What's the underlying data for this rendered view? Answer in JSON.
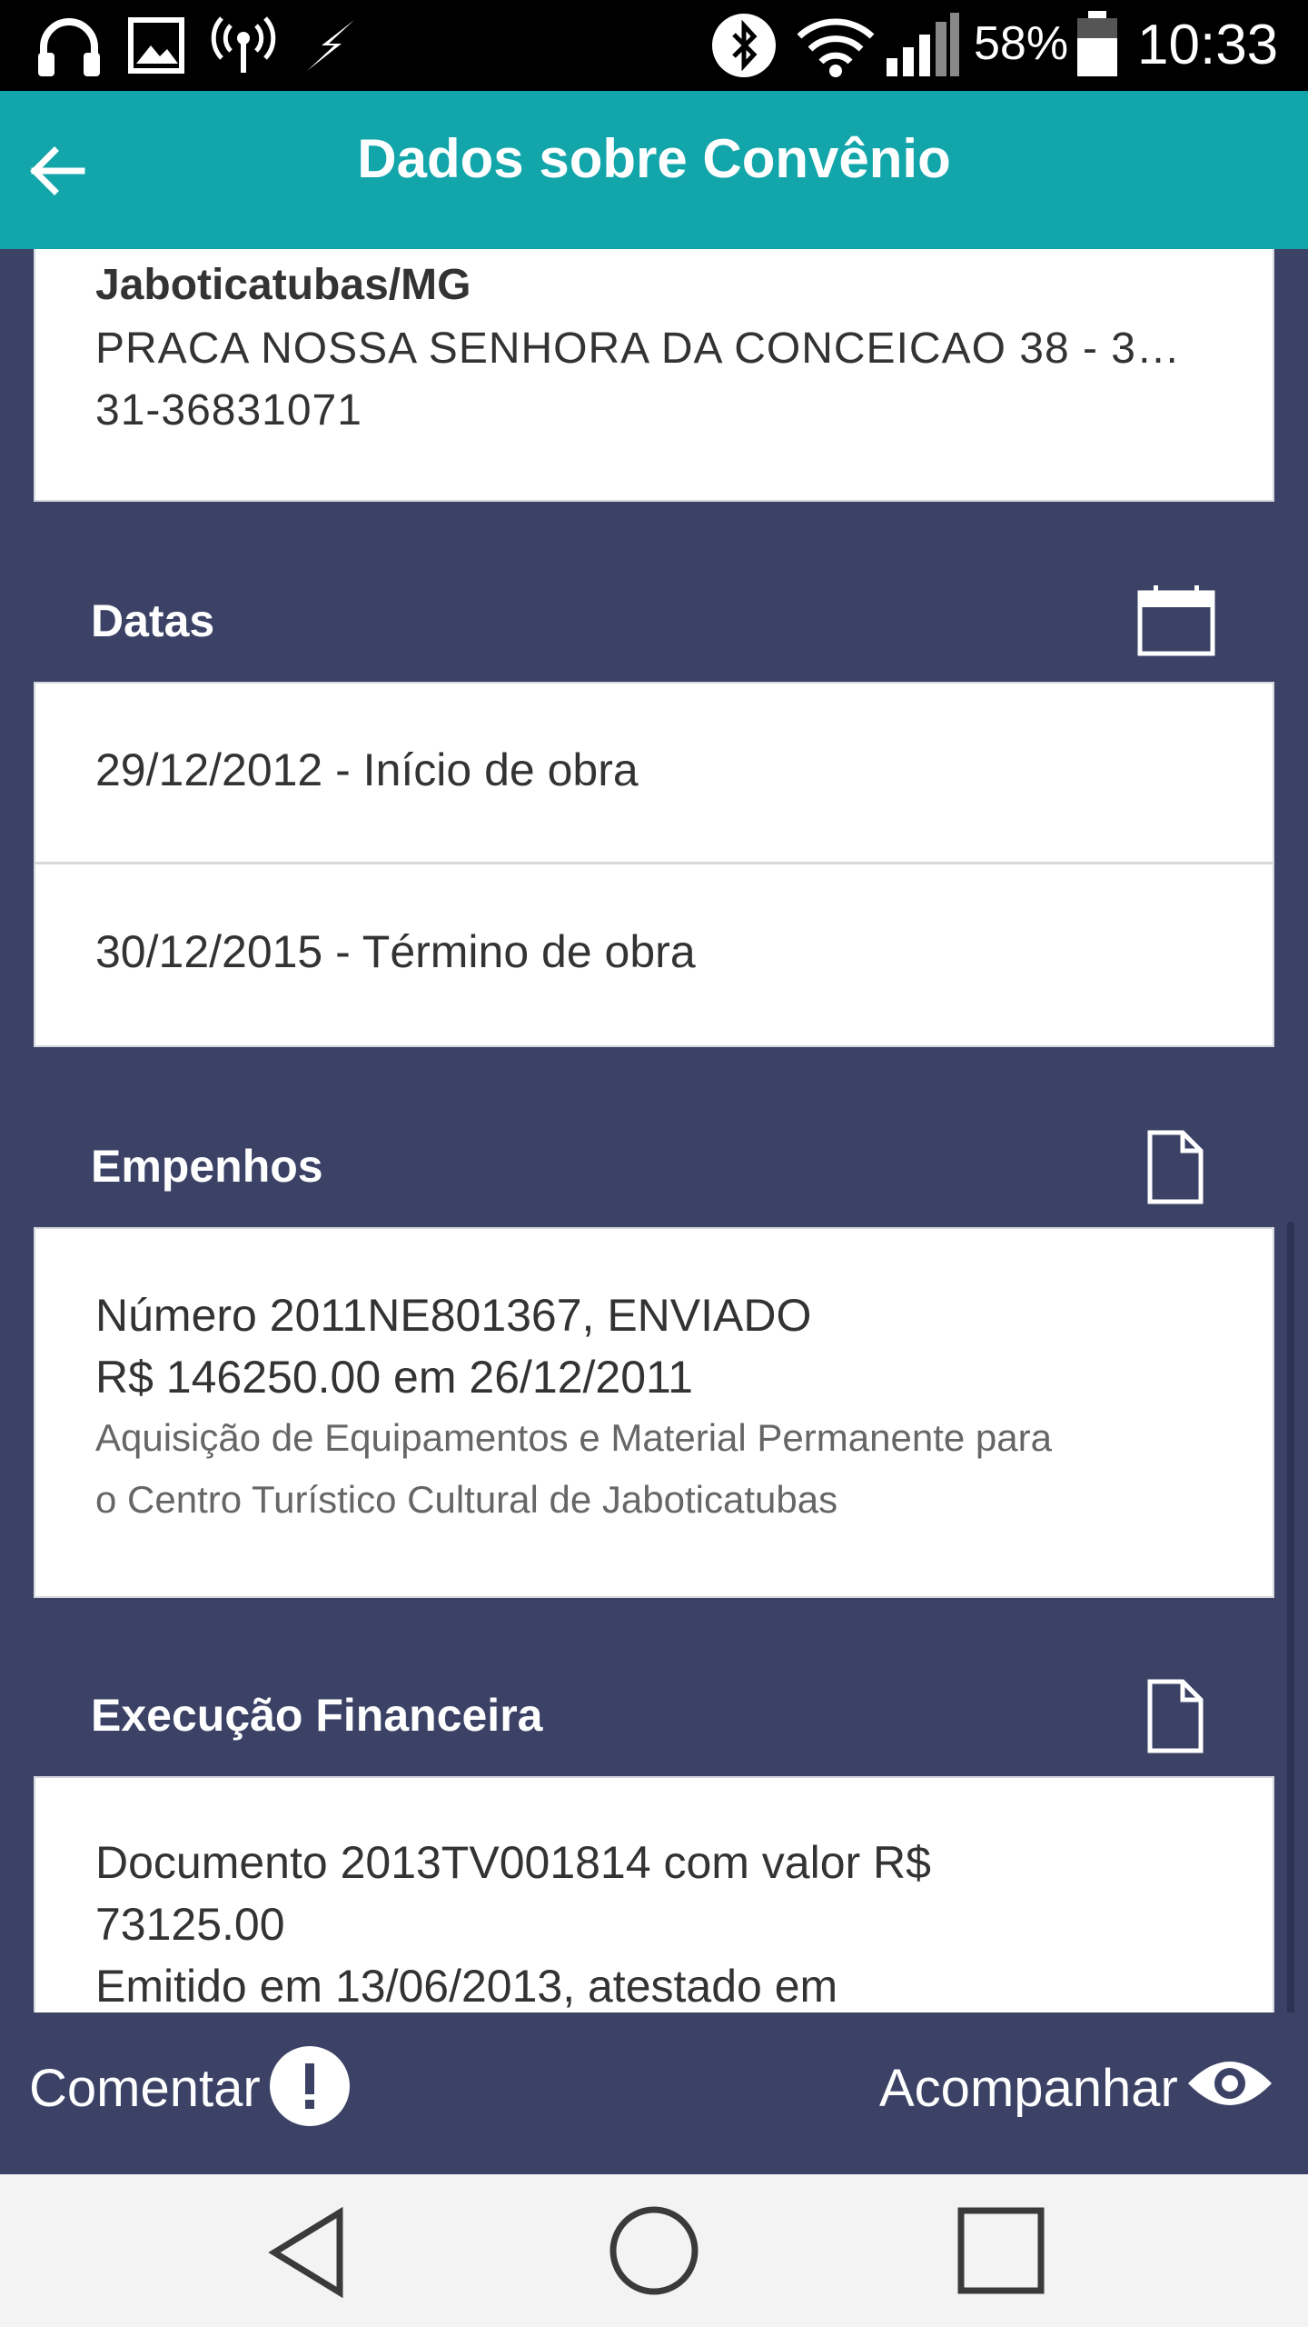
{
  "status_bar": {
    "icons": [
      "headphones-icon",
      "image-icon",
      "hotspot-icon",
      "charging-bolt-icon",
      "bluetooth-icon",
      "wifi-icon",
      "cell-signal-icon",
      "battery-icon"
    ],
    "battery": "58%",
    "time": "10:33"
  },
  "app_bar": {
    "title": "Dados sobre Convênio",
    "back_icon": "arrow-back-icon"
  },
  "contact_card": {
    "city": "Jaboticatubas/MG",
    "address": "PRACA NOSSA SENHORA DA CONCEICAO 38 - 3…",
    "phone": "31-36831071"
  },
  "datas": {
    "title": "Datas",
    "icon": "calendar-icon",
    "items": [
      "29/12/2012 - Início de obra",
      "30/12/2015 - Término de obra"
    ]
  },
  "empenhos": {
    "title": "Empenhos",
    "icon": "document-icon",
    "entry": {
      "number_line": "Número 2011NE801367, ENVIADO",
      "amount_line": "R$ 146250.00 em 26/12/2011",
      "description_line1": "Aquisição de Equipamentos e Material Permanente para",
      "description_line2": "o Centro Turístico Cultural de Jaboticatubas"
    }
  },
  "execucao": {
    "title": "Execução Financeira",
    "icon": "document-icon",
    "entry": {
      "line1": "Documento 2013TV001814 com valor R$",
      "line2": "73125.00",
      "line3": "Emitido em 13/06/2013, atestado em"
    }
  },
  "actions": {
    "comment_label": "Comentar",
    "comment_icon": "exclamation-circle-icon",
    "follow_label": "Acompanhar",
    "follow_icon": "eye-icon"
  },
  "nav_bar": {
    "icons": [
      "back-triangle-icon",
      "home-circle-icon",
      "recents-square-icon"
    ]
  },
  "colors": {
    "app_bar": "#12a5aa",
    "background": "#3b4266",
    "card": "#ffffff",
    "text": "#333333",
    "secondary_text": "#666666"
  }
}
